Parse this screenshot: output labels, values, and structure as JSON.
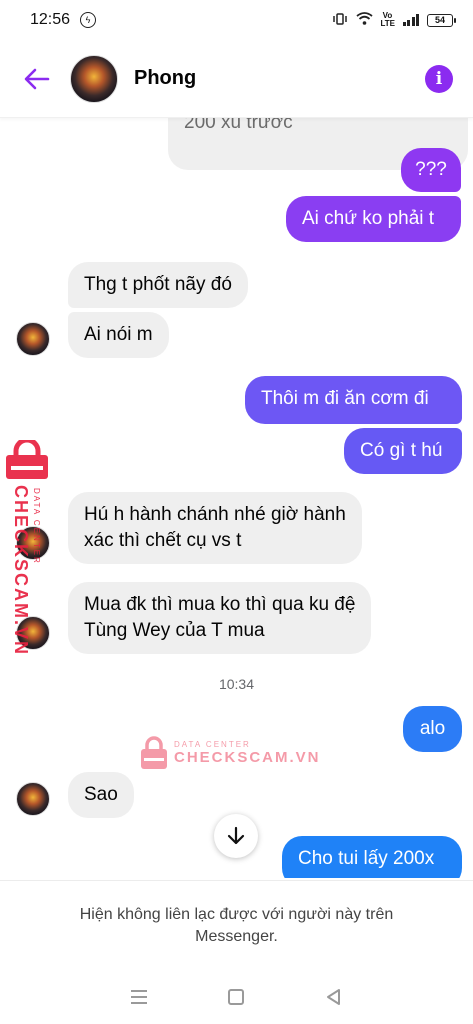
{
  "status_bar": {
    "time": "12:56",
    "network": "Vo LTE",
    "battery": "54"
  },
  "header": {
    "contact_name": "Phong",
    "back_icon": "arrow-left-icon",
    "info_icon": "info-icon",
    "accent_color": "#8b2bf0"
  },
  "messages": [
    {
      "id": "m1",
      "side": "in",
      "text": "200 xu trước"
    },
    {
      "id": "m2",
      "side": "out",
      "text": "???"
    },
    {
      "id": "m3",
      "side": "out",
      "text": "Ai chứ ko phải t"
    },
    {
      "id": "m4",
      "side": "in",
      "text": "Thg t phốt nãy đó"
    },
    {
      "id": "m5",
      "side": "in",
      "text": "Ai nói m"
    },
    {
      "id": "m6",
      "side": "out",
      "text": "Thôi m đi ăn cơm đi"
    },
    {
      "id": "m7",
      "side": "out",
      "text": "Có gì t hú"
    },
    {
      "id": "m8",
      "side": "in",
      "lines": [
        "Hú h hành chánh nhé giờ hành",
        "xác thì chết cụ vs t"
      ]
    },
    {
      "id": "m9",
      "side": "in",
      "lines": [
        "Mua đk thì mua ko thì qua ku đệ",
        "Tùng Wey của T mua"
      ]
    },
    {
      "id": "ts",
      "type": "timestamp",
      "text": "10:34"
    },
    {
      "id": "m10",
      "side": "out",
      "text": "alo"
    },
    {
      "id": "m11",
      "side": "in",
      "text": "Sao"
    },
    {
      "id": "m12",
      "side": "out",
      "text": "Cho tui lấy 200x"
    }
  ],
  "colors": {
    "incoming_bubble": "#efefef",
    "outgoing_gradient_top": "#8a3df2",
    "outgoing_gradient_mid": "#5f63f5",
    "outgoing_gradient_bottom": "#1f82f7"
  },
  "watermark": {
    "brand": "CHECKSCAM.VN",
    "tagline": "DATA CENTER",
    "color": "#e8213f"
  },
  "scroll_button_icon": "arrow-down-icon",
  "notice": "Hiện không liên lạc được với người này trên Messenger.",
  "nav": {
    "recents_icon": "menu-icon",
    "home_icon": "square-icon",
    "back_icon": "triangle-back-icon"
  }
}
